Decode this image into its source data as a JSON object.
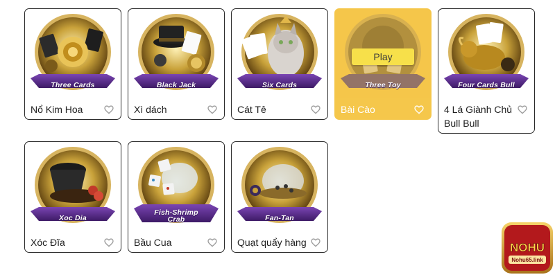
{
  "games": [
    {
      "title": "Nổ Kim Hoa",
      "ribbon": "Three Cards",
      "favorite_icon": "heart-outline-icon"
    },
    {
      "title": "Xì dách",
      "ribbon": "Black Jack",
      "favorite_icon": "heart-outline-icon"
    },
    {
      "title": "Cát Tê",
      "ribbon": "Six Cards",
      "favorite_icon": "heart-outline-icon"
    },
    {
      "title": "Bài Cào",
      "ribbon": "Three Toy",
      "favorite_icon": "heart-outline-icon",
      "play_label": "Play",
      "active": true
    },
    {
      "title": "4 Lá Giành Chủ Bull Bull",
      "ribbon": "Four Cards Bull",
      "favorite_icon": "heart-outline-icon"
    },
    {
      "title": "Xóc Đĩa",
      "ribbon": "Xoc Dia",
      "favorite_icon": "heart-outline-icon"
    },
    {
      "title": "Bầu Cua",
      "ribbon_line1": "Fish-Shrimp",
      "ribbon_line2": "Crab",
      "favorite_icon": "heart-outline-icon"
    },
    {
      "title": "Quạt quẩy hàng",
      "ribbon": "Fan-Tan",
      "favorite_icon": "heart-outline-icon"
    }
  ],
  "logo": {
    "brand": "NOHU",
    "domain": "Nohu65.link"
  },
  "colors": {
    "active_card": "#f5c74b",
    "play_button": "#f7e04a",
    "ribbon_purple": "#5a2d8c",
    "gold": "#c9a23a",
    "card_border": "#2b2b2b"
  }
}
